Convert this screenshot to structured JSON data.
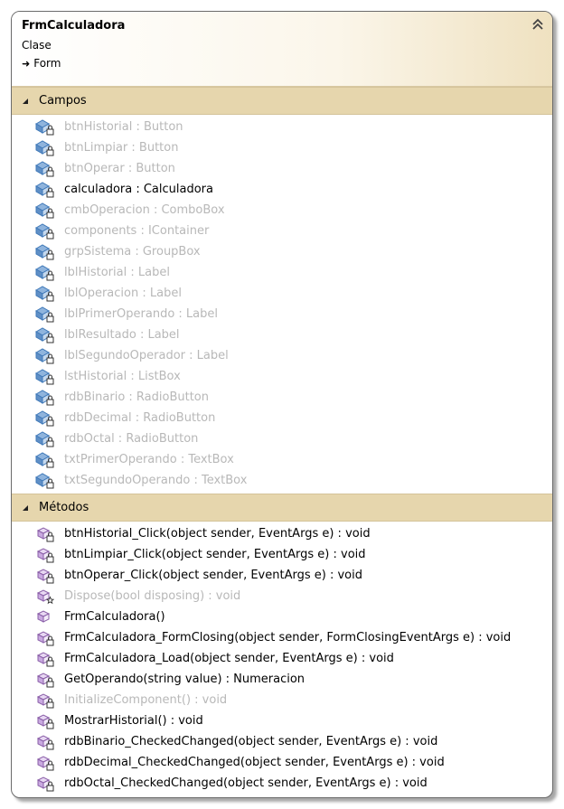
{
  "class": {
    "name": "FrmCalculadora",
    "kind": "Clase",
    "base": "Form"
  },
  "sections": {
    "fields_label": "Campos",
    "methods_label": "Métodos"
  },
  "fields": [
    {
      "text": "btnHistorial : Button",
      "style": "dim"
    },
    {
      "text": "btnLimpiar : Button",
      "style": "dim"
    },
    {
      "text": "btnOperar : Button",
      "style": "dim"
    },
    {
      "text": "calculadora : Calculadora",
      "style": "normal"
    },
    {
      "text": "cmbOperacion : ComboBox",
      "style": "dim"
    },
    {
      "text": "components : IContainer",
      "style": "dim"
    },
    {
      "text": "grpSistema : GroupBox",
      "style": "dim"
    },
    {
      "text": "lblHistorial : Label",
      "style": "dim"
    },
    {
      "text": "lblOperacion : Label",
      "style": "dim"
    },
    {
      "text": "lblPrimerOperando : Label",
      "style": "dim"
    },
    {
      "text": "lblResultado : Label",
      "style": "dim"
    },
    {
      "text": "lblSegundoOperador : Label",
      "style": "dim"
    },
    {
      "text": "lstHistorial : ListBox",
      "style": "dim"
    },
    {
      "text": "rdbBinario : RadioButton",
      "style": "dim"
    },
    {
      "text": "rdbDecimal : RadioButton",
      "style": "dim"
    },
    {
      "text": "rdbOctal : RadioButton",
      "style": "dim"
    },
    {
      "text": "txtPrimerOperando : TextBox",
      "style": "dim"
    },
    {
      "text": "txtSegundoOperando : TextBox",
      "style": "dim"
    }
  ],
  "methods": [
    {
      "text": "btnHistorial_Click(object sender, EventArgs e) : void",
      "style": "normal",
      "icon": "private-method-icon"
    },
    {
      "text": "btnLimpiar_Click(object sender, EventArgs e) : void",
      "style": "normal",
      "icon": "private-method-icon"
    },
    {
      "text": "btnOperar_Click(object sender, EventArgs e) : void",
      "style": "normal",
      "icon": "private-method-icon"
    },
    {
      "text": "Dispose(bool disposing) : void",
      "style": "dim",
      "icon": "protected-method-icon"
    },
    {
      "text": "FrmCalculadora()",
      "style": "normal",
      "icon": "public-method-icon"
    },
    {
      "text": "FrmCalculadora_FormClosing(object sender, FormClosingEventArgs e) : void",
      "style": "normal",
      "icon": "private-method-icon"
    },
    {
      "text": "FrmCalculadora_Load(object sender, EventArgs e) : void",
      "style": "normal",
      "icon": "private-method-icon"
    },
    {
      "text": "GetOperando(string value) : Numeracion",
      "style": "normal",
      "icon": "private-method-icon"
    },
    {
      "text": "InitializeComponent() : void",
      "style": "dim",
      "icon": "private-method-icon"
    },
    {
      "text": "MostrarHistorial() : void",
      "style": "normal",
      "icon": "private-method-icon"
    },
    {
      "text": "rdbBinario_CheckedChanged(object sender, EventArgs e) : void",
      "style": "normal",
      "icon": "private-method-icon"
    },
    {
      "text": "rdbDecimal_CheckedChanged(object sender, EventArgs e) : void",
      "style": "normal",
      "icon": "private-method-icon"
    },
    {
      "text": "rdbOctal_CheckedChanged(object sender, EventArgs e) : void",
      "style": "normal",
      "icon": "private-method-icon"
    }
  ],
  "colors": {
    "header_gradient_end": "#efe1c0",
    "section_band": "#e6d6ad",
    "dim_text": "#b8b8b8",
    "icon_blue": "#3f78b8"
  }
}
